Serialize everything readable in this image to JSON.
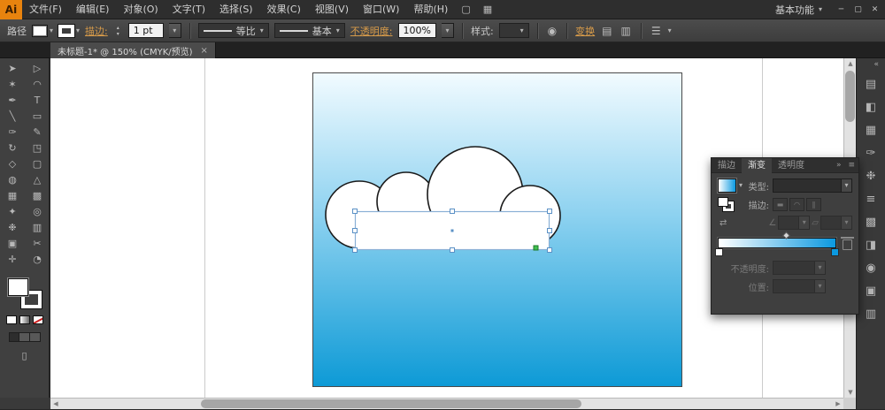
{
  "icons": {
    "caret": "▾",
    "stepper_up": "▴",
    "stepper_down": "▾",
    "minimize": "─",
    "restore": "▢",
    "close": "✕",
    "tab_close": "×",
    "chevrons_right": "»",
    "chevrons_left": "«",
    "panel_menu": "≡",
    "menu_list": "☰",
    "scroll_up": "▲",
    "scroll_down": "▼",
    "scroll_left": "◀",
    "scroll_right": "▶",
    "document": "▢",
    "arrange_documents": "▦",
    "recolor_artwork": "◉",
    "align_1": "▤",
    "align_2": "▥",
    "screen_mode": "▯"
  },
  "colors": {
    "accent_link": "#d79b4a",
    "logo_orange": "#e8830e",
    "sky_top": "#f2fbff",
    "sky_mid": "#8ed2f0",
    "sky_bottom": "#0d9ad6",
    "selection_blue": "#8ab0d6",
    "handle_border": "#5b91c6",
    "snap_green": "#3fbf4f",
    "ramp_start": "#ffffff",
    "ramp_end": "#0b99e0"
  },
  "menubar": {
    "logo": "Ai",
    "items": [
      "文件(F)",
      "编辑(E)",
      "对象(O)",
      "文字(T)",
      "选择(S)",
      "效果(C)",
      "视图(V)",
      "窗口(W)",
      "帮助(H)"
    ],
    "workspace": "基本功能"
  },
  "controlbar": {
    "object_label": "路径",
    "stroke_link": "描边:",
    "stroke_weight": "1 pt",
    "variable_width_profile": "等比",
    "brush_definition": "基本",
    "opacity_link": "不透明度:",
    "opacity_value": "100%",
    "style_label": "样式:",
    "transform_link": "变换"
  },
  "document_tab": {
    "title": "未标题-1* @ 150% (CMYK/预览)"
  },
  "toolbar": {
    "tools": [
      {
        "name": "selection",
        "glyph": "➤"
      },
      {
        "name": "direct-selection",
        "glyph": "▷"
      },
      {
        "name": "magic-wand",
        "glyph": "✶"
      },
      {
        "name": "lasso",
        "glyph": "◠"
      },
      {
        "name": "pen",
        "glyph": "✒"
      },
      {
        "name": "type",
        "glyph": "T"
      },
      {
        "name": "line-segment",
        "glyph": "╲"
      },
      {
        "name": "rectangle",
        "glyph": "▭"
      },
      {
        "name": "paintbrush",
        "glyph": "✑"
      },
      {
        "name": "pencil",
        "glyph": "✎"
      },
      {
        "name": "rotate",
        "glyph": "↻"
      },
      {
        "name": "scale",
        "glyph": "◳"
      },
      {
        "name": "width",
        "glyph": "◇"
      },
      {
        "name": "free-transform",
        "glyph": "▢"
      },
      {
        "name": "shape-builder",
        "glyph": "◍"
      },
      {
        "name": "perspective-grid",
        "glyph": "△"
      },
      {
        "name": "mesh",
        "glyph": "▦"
      },
      {
        "name": "gradient",
        "glyph": "▩"
      },
      {
        "name": "eyedropper",
        "glyph": "✦"
      },
      {
        "name": "blend",
        "glyph": "◎"
      },
      {
        "name": "symbol-sprayer",
        "glyph": "❉"
      },
      {
        "name": "column-graph",
        "glyph": "▥"
      },
      {
        "name": "artboard",
        "glyph": "▣"
      },
      {
        "name": "slice",
        "glyph": "✂"
      },
      {
        "name": "hand",
        "glyph": "✛"
      },
      {
        "name": "zoom",
        "glyph": "◔"
      }
    ]
  },
  "gradient_panel": {
    "tabs": [
      "描边",
      "渐变",
      "透明度"
    ],
    "active_tab": "渐变",
    "type_label": "类型:",
    "stroke_label": "描边:",
    "opacity_label": "不透明度:",
    "location_label": "位置:",
    "icons": {
      "reverse": "⇄",
      "angle": "∠",
      "aspect": "▱",
      "stroke_btn_1": "▬",
      "stroke_btn_2": "◠",
      "stroke_btn_3": "∥"
    }
  },
  "dock": {
    "icons": [
      {
        "name": "color",
        "glyph": "▤"
      },
      {
        "name": "color-guide",
        "glyph": "◧"
      },
      {
        "name": "swatches",
        "glyph": "▦"
      },
      {
        "name": "brushes",
        "glyph": "✑"
      },
      {
        "name": "symbols",
        "glyph": "❉"
      },
      {
        "name": "stroke",
        "glyph": "≡"
      },
      {
        "name": "gradient",
        "glyph": "▩"
      },
      {
        "name": "transparency",
        "glyph": "◨"
      },
      {
        "name": "appearance",
        "glyph": "◉"
      },
      {
        "name": "graphic-styles",
        "glyph": "▣"
      },
      {
        "name": "layers",
        "glyph": "▥"
      }
    ]
  }
}
